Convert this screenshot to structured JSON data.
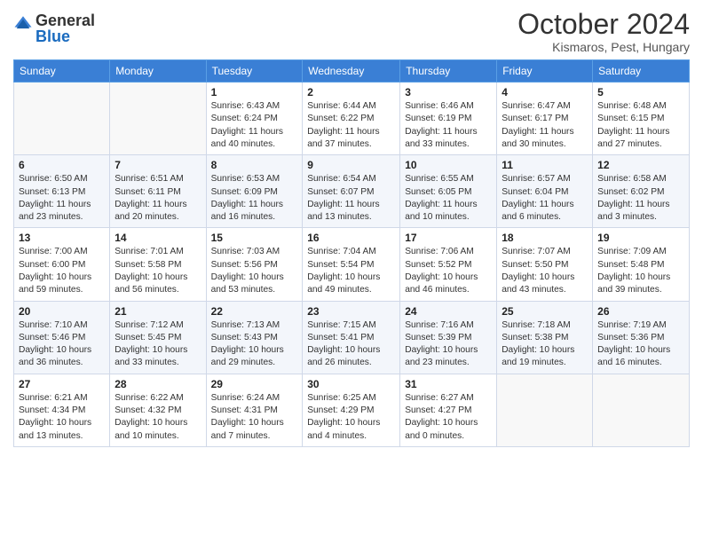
{
  "header": {
    "logo_general": "General",
    "logo_blue": "Blue",
    "title": "October 2024",
    "location": "Kismaros, Pest, Hungary"
  },
  "days_of_week": [
    "Sunday",
    "Monday",
    "Tuesday",
    "Wednesday",
    "Thursday",
    "Friday",
    "Saturday"
  ],
  "weeks": [
    [
      {
        "num": "",
        "sunrise": "",
        "sunset": "",
        "daylight": ""
      },
      {
        "num": "",
        "sunrise": "",
        "sunset": "",
        "daylight": ""
      },
      {
        "num": "1",
        "sunrise": "Sunrise: 6:43 AM",
        "sunset": "Sunset: 6:24 PM",
        "daylight": "Daylight: 11 hours and 40 minutes."
      },
      {
        "num": "2",
        "sunrise": "Sunrise: 6:44 AM",
        "sunset": "Sunset: 6:22 PM",
        "daylight": "Daylight: 11 hours and 37 minutes."
      },
      {
        "num": "3",
        "sunrise": "Sunrise: 6:46 AM",
        "sunset": "Sunset: 6:19 PM",
        "daylight": "Daylight: 11 hours and 33 minutes."
      },
      {
        "num": "4",
        "sunrise": "Sunrise: 6:47 AM",
        "sunset": "Sunset: 6:17 PM",
        "daylight": "Daylight: 11 hours and 30 minutes."
      },
      {
        "num": "5",
        "sunrise": "Sunrise: 6:48 AM",
        "sunset": "Sunset: 6:15 PM",
        "daylight": "Daylight: 11 hours and 27 minutes."
      }
    ],
    [
      {
        "num": "6",
        "sunrise": "Sunrise: 6:50 AM",
        "sunset": "Sunset: 6:13 PM",
        "daylight": "Daylight: 11 hours and 23 minutes."
      },
      {
        "num": "7",
        "sunrise": "Sunrise: 6:51 AM",
        "sunset": "Sunset: 6:11 PM",
        "daylight": "Daylight: 11 hours and 20 minutes."
      },
      {
        "num": "8",
        "sunrise": "Sunrise: 6:53 AM",
        "sunset": "Sunset: 6:09 PM",
        "daylight": "Daylight: 11 hours and 16 minutes."
      },
      {
        "num": "9",
        "sunrise": "Sunrise: 6:54 AM",
        "sunset": "Sunset: 6:07 PM",
        "daylight": "Daylight: 11 hours and 13 minutes."
      },
      {
        "num": "10",
        "sunrise": "Sunrise: 6:55 AM",
        "sunset": "Sunset: 6:05 PM",
        "daylight": "Daylight: 11 hours and 10 minutes."
      },
      {
        "num": "11",
        "sunrise": "Sunrise: 6:57 AM",
        "sunset": "Sunset: 6:04 PM",
        "daylight": "Daylight: 11 hours and 6 minutes."
      },
      {
        "num": "12",
        "sunrise": "Sunrise: 6:58 AM",
        "sunset": "Sunset: 6:02 PM",
        "daylight": "Daylight: 11 hours and 3 minutes."
      }
    ],
    [
      {
        "num": "13",
        "sunrise": "Sunrise: 7:00 AM",
        "sunset": "Sunset: 6:00 PM",
        "daylight": "Daylight: 10 hours and 59 minutes."
      },
      {
        "num": "14",
        "sunrise": "Sunrise: 7:01 AM",
        "sunset": "Sunset: 5:58 PM",
        "daylight": "Daylight: 10 hours and 56 minutes."
      },
      {
        "num": "15",
        "sunrise": "Sunrise: 7:03 AM",
        "sunset": "Sunset: 5:56 PM",
        "daylight": "Daylight: 10 hours and 53 minutes."
      },
      {
        "num": "16",
        "sunrise": "Sunrise: 7:04 AM",
        "sunset": "Sunset: 5:54 PM",
        "daylight": "Daylight: 10 hours and 49 minutes."
      },
      {
        "num": "17",
        "sunrise": "Sunrise: 7:06 AM",
        "sunset": "Sunset: 5:52 PM",
        "daylight": "Daylight: 10 hours and 46 minutes."
      },
      {
        "num": "18",
        "sunrise": "Sunrise: 7:07 AM",
        "sunset": "Sunset: 5:50 PM",
        "daylight": "Daylight: 10 hours and 43 minutes."
      },
      {
        "num": "19",
        "sunrise": "Sunrise: 7:09 AM",
        "sunset": "Sunset: 5:48 PM",
        "daylight": "Daylight: 10 hours and 39 minutes."
      }
    ],
    [
      {
        "num": "20",
        "sunrise": "Sunrise: 7:10 AM",
        "sunset": "Sunset: 5:46 PM",
        "daylight": "Daylight: 10 hours and 36 minutes."
      },
      {
        "num": "21",
        "sunrise": "Sunrise: 7:12 AM",
        "sunset": "Sunset: 5:45 PM",
        "daylight": "Daylight: 10 hours and 33 minutes."
      },
      {
        "num": "22",
        "sunrise": "Sunrise: 7:13 AM",
        "sunset": "Sunset: 5:43 PM",
        "daylight": "Daylight: 10 hours and 29 minutes."
      },
      {
        "num": "23",
        "sunrise": "Sunrise: 7:15 AM",
        "sunset": "Sunset: 5:41 PM",
        "daylight": "Daylight: 10 hours and 26 minutes."
      },
      {
        "num": "24",
        "sunrise": "Sunrise: 7:16 AM",
        "sunset": "Sunset: 5:39 PM",
        "daylight": "Daylight: 10 hours and 23 minutes."
      },
      {
        "num": "25",
        "sunrise": "Sunrise: 7:18 AM",
        "sunset": "Sunset: 5:38 PM",
        "daylight": "Daylight: 10 hours and 19 minutes."
      },
      {
        "num": "26",
        "sunrise": "Sunrise: 7:19 AM",
        "sunset": "Sunset: 5:36 PM",
        "daylight": "Daylight: 10 hours and 16 minutes."
      }
    ],
    [
      {
        "num": "27",
        "sunrise": "Sunrise: 6:21 AM",
        "sunset": "Sunset: 4:34 PM",
        "daylight": "Daylight: 10 hours and 13 minutes."
      },
      {
        "num": "28",
        "sunrise": "Sunrise: 6:22 AM",
        "sunset": "Sunset: 4:32 PM",
        "daylight": "Daylight: 10 hours and 10 minutes."
      },
      {
        "num": "29",
        "sunrise": "Sunrise: 6:24 AM",
        "sunset": "Sunset: 4:31 PM",
        "daylight": "Daylight: 10 hours and 7 minutes."
      },
      {
        "num": "30",
        "sunrise": "Sunrise: 6:25 AM",
        "sunset": "Sunset: 4:29 PM",
        "daylight": "Daylight: 10 hours and 4 minutes."
      },
      {
        "num": "31",
        "sunrise": "Sunrise: 6:27 AM",
        "sunset": "Sunset: 4:27 PM",
        "daylight": "Daylight: 10 hours and 0 minutes."
      },
      {
        "num": "",
        "sunrise": "",
        "sunset": "",
        "daylight": ""
      },
      {
        "num": "",
        "sunrise": "",
        "sunset": "",
        "daylight": ""
      }
    ]
  ]
}
